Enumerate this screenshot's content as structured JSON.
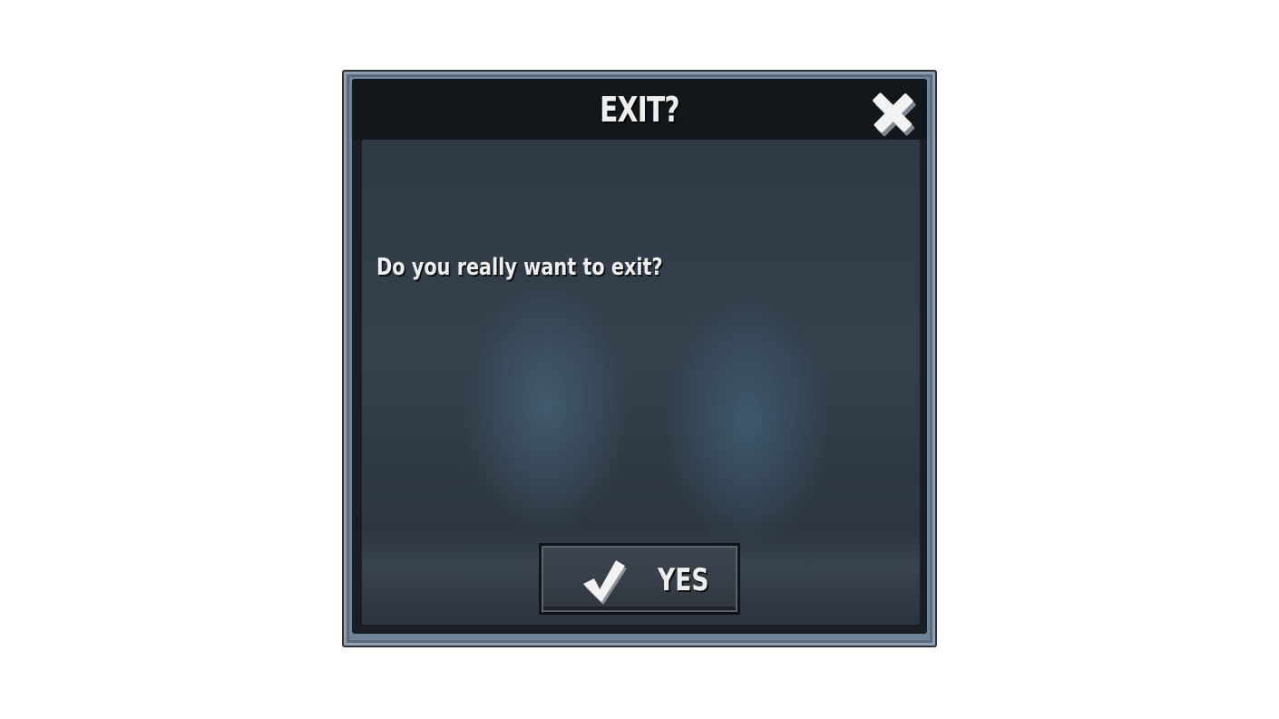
{
  "dialog": {
    "title": "EXIT?",
    "message": "Do you really want to exit?",
    "close_icon": "close-icon",
    "confirm_button": {
      "label": "YES",
      "icon": "checkmark-icon"
    }
  },
  "colors": {
    "frame": "#6f8599",
    "title_bar": "#12171b",
    "panel": "#34404c",
    "text": "#eeeeee"
  }
}
